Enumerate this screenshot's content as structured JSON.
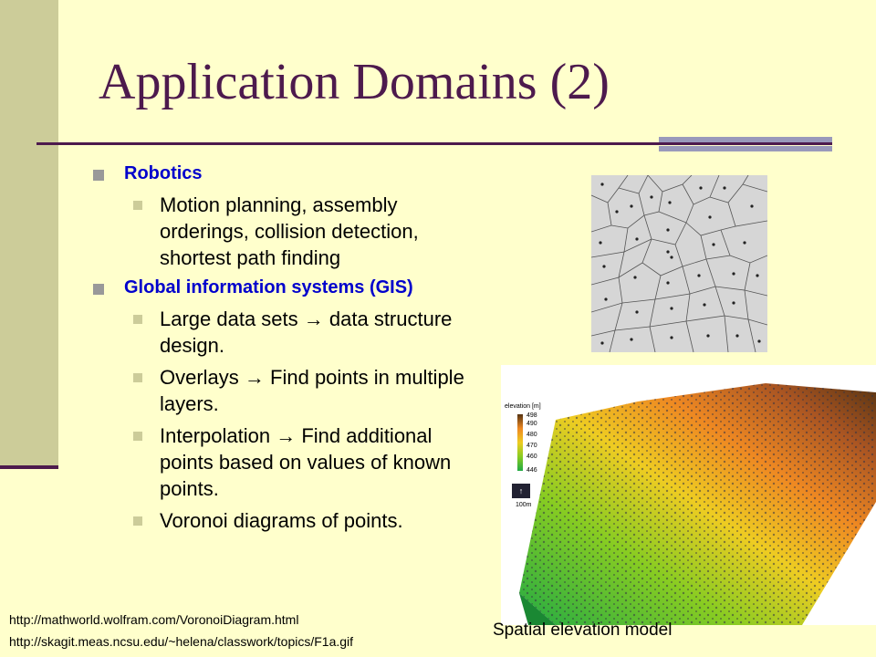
{
  "slide": {
    "title": "Application Domains (2)",
    "bullets": [
      {
        "text": "Robotics",
        "subs": [
          "Motion planning, assembly orderings, collision detection, shortest path finding"
        ]
      },
      {
        "text": "Global information systems (GIS)",
        "subs": [
          {
            "before": "Large data sets ",
            "arrow": "→",
            "after": " data structure design."
          },
          {
            "before": "Overlays ",
            "arrow": "→",
            "after": " Find points in multiple layers."
          },
          {
            "before": "Interpolation ",
            "arrow": "→",
            "after": " Find additional points based on values of known points."
          },
          {
            "before": "Voronoi diagrams of points.",
            "arrow": "",
            "after": ""
          }
        ]
      }
    ],
    "caption": "Spatial elevation model",
    "sources": [
      "http://mathworld.wolfram.com/VoronoiDiagram.html",
      "http://skagit.meas.ncsu.edu/~helena/classwork/topics/F1a.gif"
    ],
    "elevation_legend": {
      "title": "elevation [m]",
      "ticks": [
        "498",
        "490",
        "480",
        "470",
        "460",
        "446"
      ],
      "scale": "100m"
    },
    "colors": {
      "background": "#ffffcc",
      "sidebar": "#cccc99",
      "title": "#4d1a4d",
      "heading": "#0000cc"
    }
  }
}
